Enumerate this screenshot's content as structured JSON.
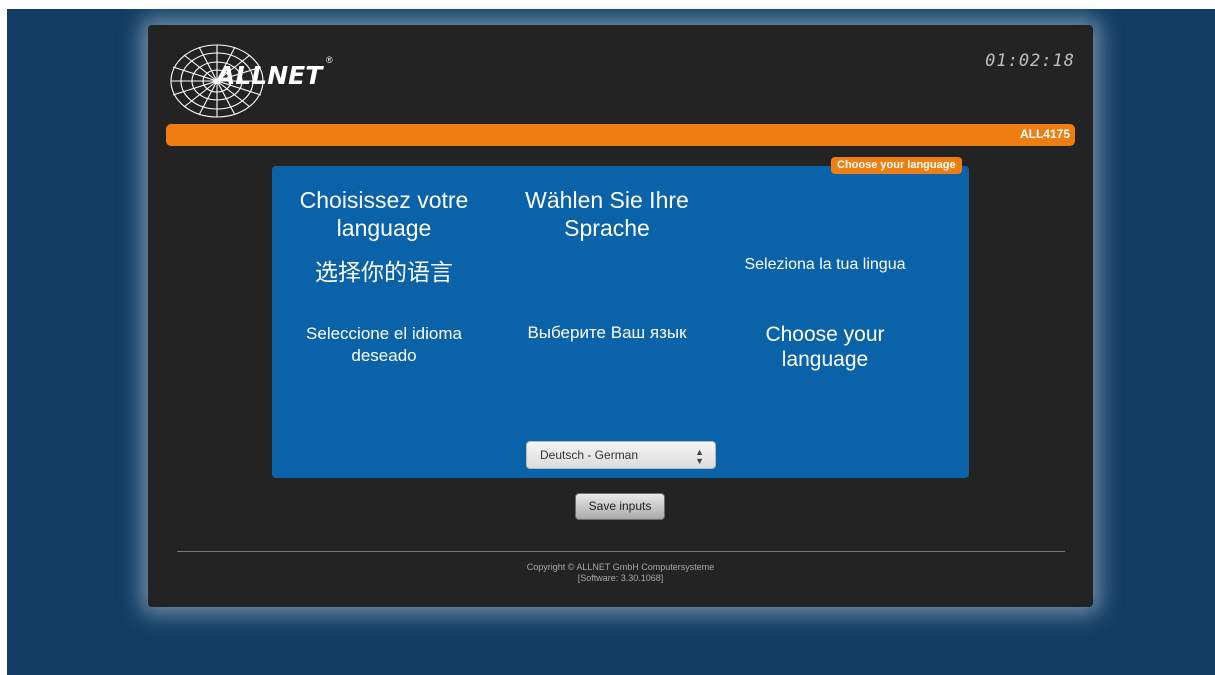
{
  "header": {
    "logo_text": "ALLNET",
    "logo_mark": "®",
    "clock": "01:02:18"
  },
  "device": {
    "model": "ALL4175"
  },
  "language_panel": {
    "tag": "Choose your language",
    "prompts": {
      "french": "Choisissez votre language",
      "german": "Wählen Sie Ihre Sprache",
      "chinese": "选择你的语言",
      "italian": "Seleziona la tua lingua",
      "spanish": "Seleccione el idioma deseado",
      "russian": "Выберите Ваш язык",
      "english": "Choose your language"
    },
    "select": {
      "selected": "Deutsch - German"
    }
  },
  "actions": {
    "save_label": "Save inputs"
  },
  "footer": {
    "copyright": "Copyright © ALLNET GmbH Computersysteme",
    "software": "[Software: 3.30.1068]"
  },
  "colors": {
    "page_background": "#133d63",
    "panel": "#232323",
    "accent_orange": "#ee7d12",
    "language_box": "#0a62a8"
  }
}
